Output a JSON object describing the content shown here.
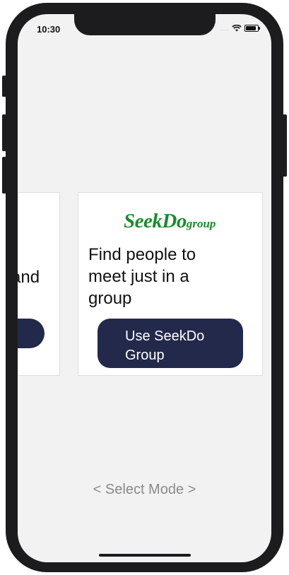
{
  "status_bar": {
    "time": "10:30",
    "signal": "....",
    "wifi_icon": "wifi-icon",
    "battery_icon": "battery-icon"
  },
  "cards": {
    "left": {
      "text": "and"
    },
    "main": {
      "logo_main": "SeekDo",
      "logo_sub": "group",
      "logo_color": "#1b8a2e",
      "description": " Find people to\nmeet just in a\ngroup",
      "button_label": "Use SeekDo Group",
      "button_color": "#23294a"
    }
  },
  "footer": {
    "select_mode": "< Select Mode >"
  }
}
